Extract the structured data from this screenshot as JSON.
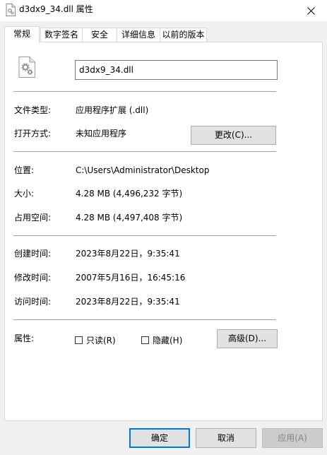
{
  "window": {
    "title": "d3dx9_34.dll 属性",
    "close_glyph": "✕"
  },
  "tabs": [
    {
      "label": "常规",
      "active": true
    },
    {
      "label": "数字签名",
      "active": false
    },
    {
      "label": "安全",
      "active": false
    },
    {
      "label": "详细信息",
      "active": false
    },
    {
      "label": "以前的版本",
      "active": false
    }
  ],
  "general": {
    "file_name": "d3dx9_34.dll",
    "file_type_label": "文件类型:",
    "file_type_value": "应用程序扩展 (.dll)",
    "opens_with_label": "打开方式:",
    "opens_with_value": "未知应用程序",
    "change_button": "更改(C)...",
    "location_label": "位置:",
    "location_value": "C:\\Users\\Administrator\\Desktop",
    "size_label": "大小:",
    "size_value": "4.28 MB (4,496,232 字节)",
    "size_on_disk_label": "占用空间:",
    "size_on_disk_value": "4.28 MB (4,497,408 字节)",
    "created_label": "创建时间:",
    "created_value": "2023年8月22日，9:35:41",
    "modified_label": "修改时间:",
    "modified_value": "2007年5月16日，16:45:16",
    "accessed_label": "访问时间:",
    "accessed_value": "2023年8月22日，9:35:41",
    "attributes_label": "属性:",
    "readonly_label": "只读(R)",
    "readonly_checked": false,
    "hidden_label": "隐藏(H)",
    "hidden_checked": false,
    "advanced_button": "高级(D)..."
  },
  "footer": {
    "ok": "确定",
    "cancel": "取消",
    "apply": "应用(A)"
  }
}
